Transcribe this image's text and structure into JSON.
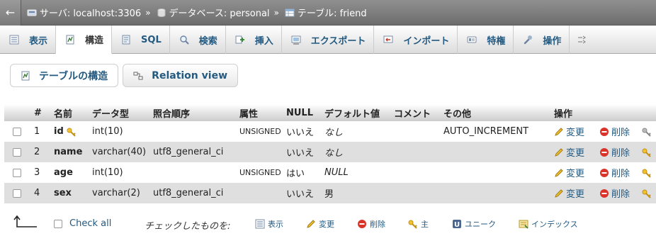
{
  "breadcrumb": {
    "back": "←",
    "server": "サーバ: localhost:3306",
    "database": "データベース: personal",
    "table": "テーブル: friend",
    "separator": "»"
  },
  "tabs": [
    {
      "label": "表示",
      "icon": "browse-icon"
    },
    {
      "label": "構造",
      "icon": "structure-icon",
      "active": true
    },
    {
      "label": "SQL",
      "icon": "sql-icon"
    },
    {
      "label": "検索",
      "icon": "search-icon"
    },
    {
      "label": "挿入",
      "icon": "insert-icon"
    },
    {
      "label": "エクスポート",
      "icon": "export-icon"
    },
    {
      "label": "インポート",
      "icon": "import-icon"
    },
    {
      "label": "特権",
      "icon": "privileges-icon"
    },
    {
      "label": "操作",
      "icon": "wrench-icon"
    }
  ],
  "subnav": {
    "structure": "テーブルの構造",
    "relation": "Relation view"
  },
  "table": {
    "headers": {
      "num": "#",
      "name": "名前",
      "type": "データ型",
      "collation": "照合順序",
      "attributes": "属性",
      "null": "NULL",
      "default": "デフォルト値",
      "comment": "コメント",
      "extra": "その他",
      "action": "操作"
    },
    "rows": [
      {
        "num": "1",
        "name": "id",
        "type": "int(10)",
        "collation": "",
        "attributes": "UNSIGNED",
        "null": "いいえ",
        "default": "なし",
        "comment": "",
        "extra": "AUTO_INCREMENT"
      },
      {
        "num": "2",
        "name": "name",
        "type": "varchar(40)",
        "collation": "utf8_general_ci",
        "attributes": "",
        "null": "いいえ",
        "default": "なし",
        "comment": "",
        "extra": ""
      },
      {
        "num": "3",
        "name": "age",
        "type": "int(10)",
        "collation": "",
        "attributes": "UNSIGNED",
        "null": "はい",
        "default": "NULL",
        "comment": "",
        "extra": ""
      },
      {
        "num": "4",
        "name": "sex",
        "type": "varchar(2)",
        "collation": "utf8_general_ci",
        "attributes": "",
        "null": "いいえ",
        "default": "男",
        "comment": "",
        "extra": ""
      }
    ],
    "actions": {
      "edit": "変更",
      "delete": "削除"
    }
  },
  "footer": {
    "check_all": "Check all",
    "with_selected": "チェックしたものを:",
    "browse": "表示",
    "change": "変更",
    "drop": "削除",
    "primary": "主",
    "unique": "ユニーク",
    "index": "インデックス"
  },
  "colors": {
    "link": "#235a81",
    "delete_red": "#d9332a",
    "key_gold": "#e0a81c"
  }
}
